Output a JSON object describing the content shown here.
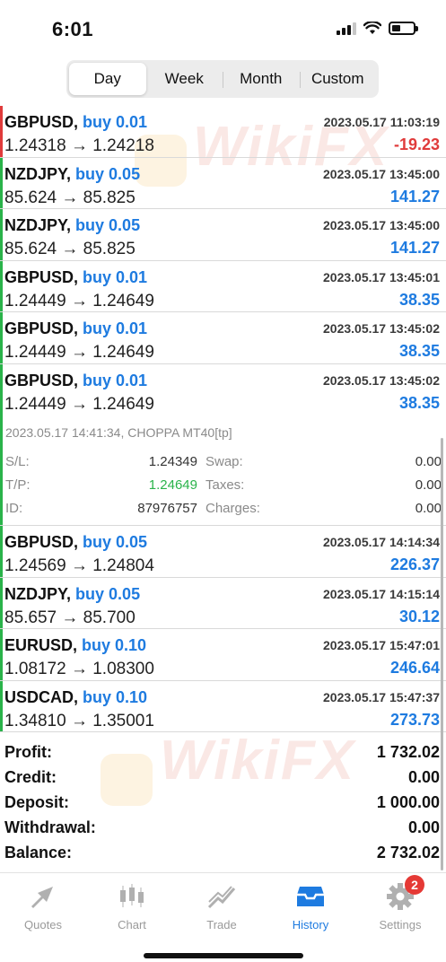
{
  "status_bar": {
    "time": "6:01"
  },
  "segments": [
    {
      "label": "Day",
      "active": true
    },
    {
      "label": "Week",
      "active": false
    },
    {
      "label": "Month",
      "active": false
    },
    {
      "label": "Custom",
      "active": false
    }
  ],
  "trades": [
    {
      "symbol": "GBPUSD,",
      "side": "buy 0.01",
      "prices": "1.24318 → 1.24218",
      "time": "2023.05.17 11:03:19",
      "profit": "-19.23",
      "positive": false
    },
    {
      "symbol": "NZDJPY,",
      "side": "buy 0.05",
      "prices": "85.624 → 85.825",
      "time": "2023.05.17 13:45:00",
      "profit": "141.27",
      "positive": true
    },
    {
      "symbol": "NZDJPY,",
      "side": "buy 0.05",
      "prices": "85.624 → 85.825",
      "time": "2023.05.17 13:45:00",
      "profit": "141.27",
      "positive": true
    },
    {
      "symbol": "GBPUSD,",
      "side": "buy 0.01",
      "prices": "1.24449 → 1.24649",
      "time": "2023.05.17 13:45:01",
      "profit": "38.35",
      "positive": true
    },
    {
      "symbol": "GBPUSD,",
      "side": "buy 0.01",
      "prices": "1.24449 → 1.24649",
      "time": "2023.05.17 13:45:02",
      "profit": "38.35",
      "positive": true
    },
    {
      "symbol": "GBPUSD,",
      "side": "buy 0.01",
      "prices": "1.24449 → 1.24649",
      "time": "2023.05.17 13:45:02",
      "profit": "38.35",
      "positive": true
    }
  ],
  "details": {
    "header": "2023.05.17 14:41:34, CHOPPA MT40[tp]",
    "sl_label": "S/L:",
    "sl_value": "1.24349",
    "swap_label": "Swap:",
    "swap_value": "0.00",
    "tp_label": "T/P:",
    "tp_value": "1.24649",
    "taxes_label": "Taxes:",
    "taxes_value": "0.00",
    "id_label": "ID:",
    "id_value": "87976757",
    "charges_label": "Charges:",
    "charges_value": "0.00"
  },
  "trades_after": [
    {
      "symbol": "GBPUSD,",
      "side": "buy 0.05",
      "prices": "1.24569 → 1.24804",
      "time": "2023.05.17 14:14:34",
      "profit": "226.37",
      "positive": true
    },
    {
      "symbol": "NZDJPY,",
      "side": "buy 0.05",
      "prices": "85.657 → 85.700",
      "time": "2023.05.17 14:15:14",
      "profit": "30.12",
      "positive": true
    },
    {
      "symbol": "EURUSD,",
      "side": "buy 0.10",
      "prices": "1.08172 → 1.08300",
      "time": "2023.05.17 15:47:01",
      "profit": "246.64",
      "positive": true
    },
    {
      "symbol": "USDCAD,",
      "side": "buy 0.10",
      "prices": "1.34810 → 1.35001",
      "time": "2023.05.17 15:47:37",
      "profit": "273.73",
      "positive": true
    }
  ],
  "summary": [
    {
      "label": "Profit:",
      "value": "1 732.02"
    },
    {
      "label": "Credit:",
      "value": "0.00"
    },
    {
      "label": "Deposit:",
      "value": "1 000.00"
    },
    {
      "label": "Withdrawal:",
      "value": "0.00"
    },
    {
      "label": "Balance:",
      "value": "2 732.02"
    }
  ],
  "watermark": "WikiFX",
  "tabs": [
    {
      "label": "Quotes",
      "icon": "quotes-icon",
      "active": false
    },
    {
      "label": "Chart",
      "icon": "chart-icon",
      "active": false
    },
    {
      "label": "Trade",
      "icon": "trade-icon",
      "active": false
    },
    {
      "label": "History",
      "icon": "history-icon",
      "active": true
    },
    {
      "label": "Settings",
      "icon": "settings-icon",
      "active": false,
      "badge": "2"
    }
  ],
  "colors": {
    "accent": "#1e7be0",
    "loss": "#e03b3b",
    "buy_bar": "#2ab34a",
    "sell_bar": "#e03b3b"
  }
}
